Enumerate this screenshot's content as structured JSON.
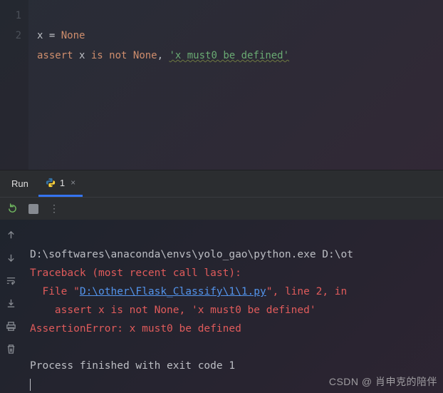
{
  "editor": {
    "lines": [
      "1",
      "2"
    ],
    "l1": {
      "ident": "x",
      "op": " = ",
      "kw": "None"
    },
    "l2": {
      "kw1": "assert ",
      "ident1": "x ",
      "kw2": "is not ",
      "kw3": "None",
      "comma": ", ",
      "str": "'x must0 be defined'"
    }
  },
  "run": {
    "label": "Run",
    "tab_name": "1",
    "close": "×",
    "dots": "⋮"
  },
  "console": {
    "cmd": "D:\\softwares\\anaconda\\envs\\yolo_gao\\python.exe D:\\ot",
    "trace1": "Traceback (most recent call last):",
    "file_pre": "  File \"",
    "file_link": "D:\\other\\Flask_Classify\\1\\1.py",
    "file_post": "\", line 2, in ",
    "assert_line": "    assert x is not None, 'x must0 be defined'",
    "error": "AssertionError: x must0 be defined",
    "exit": "Process finished with exit code 1"
  },
  "watermark": "CSDN @ 肖申克的陪伴"
}
